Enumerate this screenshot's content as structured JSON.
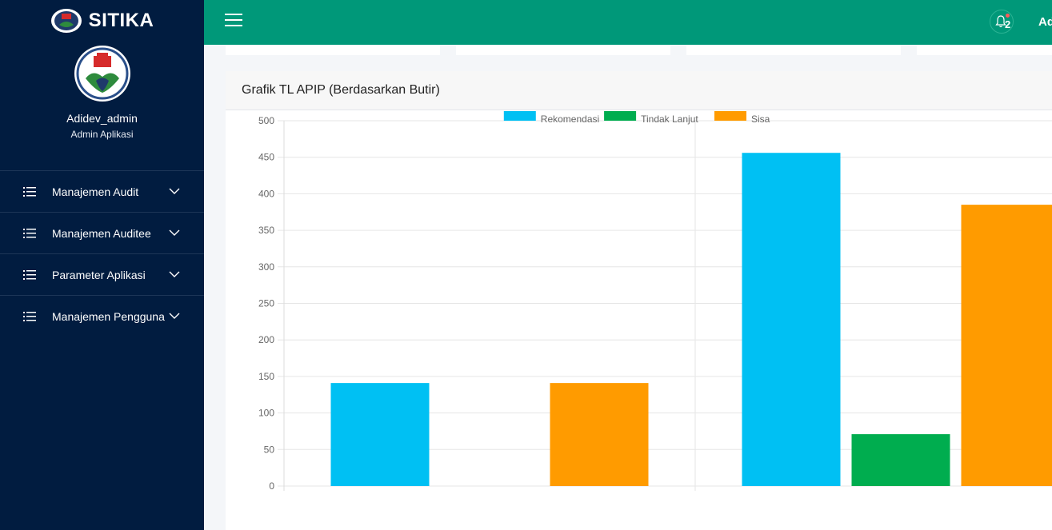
{
  "app": {
    "brand": "SITIKA"
  },
  "user": {
    "name": "Adidev_admin",
    "role": "Admin Aplikasi",
    "top_name": "Ad"
  },
  "notifications": {
    "count": "2"
  },
  "menu": [
    {
      "label": "Manajemen Audit"
    },
    {
      "label": "Manajemen Auditee"
    },
    {
      "label": "Parameter Aplikasi"
    },
    {
      "label": "Manajemen Pengguna"
    }
  ],
  "panel": {
    "title": "Grafik TL APIP (Berdasarkan Butir)"
  },
  "colors": {
    "sidebar": "#011c40",
    "topbar": "#009879",
    "rekomendasi": "#00c0f3",
    "tindak_lanjut": "#00ad4f",
    "sisa": "#ff9b00"
  },
  "chart_data": {
    "type": "bar",
    "categories": [
      "",
      ""
    ],
    "series": [
      {
        "name": "Rekomendasi",
        "color": "#00c0f3",
        "values": [
          141,
          456
        ]
      },
      {
        "name": "Tindak Lanjut",
        "color": "#00ad4f",
        "values": [
          0,
          71
        ]
      },
      {
        "name": "Sisa",
        "color": "#ff9b00",
        "values": [
          141,
          385
        ]
      }
    ],
    "ylim": [
      0,
      500
    ],
    "yticks": [
      0,
      50,
      100,
      150,
      200,
      250,
      300,
      350,
      400,
      450,
      500
    ],
    "grid": true,
    "legend": "top"
  }
}
